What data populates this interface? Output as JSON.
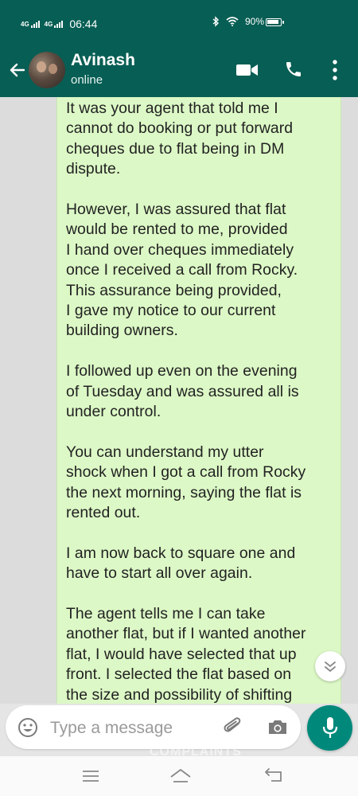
{
  "status_bar": {
    "network1": "4G",
    "network2": "4G",
    "time": "06:44",
    "bluetooth_icon": "bluetooth-icon",
    "wifi_icon": "wifi-icon",
    "battery_percent": "90%",
    "battery_level": 0.9
  },
  "header": {
    "contact_name": "Avinash",
    "contact_status": "online",
    "icons": [
      "back-arrow-icon",
      "avatar",
      "video-call-icon",
      "phone-call-icon",
      "more-vert-icon"
    ]
  },
  "chat": {
    "background": "#dcdcdc",
    "bubble_color": "#dcf8c6",
    "paragraphs": [
      "It was your agent that told me I\ncannot do booking or put forward\ncheques due to flat being in DM\ndispute.",
      "However, I was assured that flat\nwould be rented to me, provided\nI hand over cheques immediately\nonce I received a call from Rocky.\nThis assurance being provided,\nI gave my notice to our current\nbuilding owners.",
      "I followed up even on the evening\nof Tuesday and was assured all is\nunder control.",
      "You can understand my utter\nshock when I got a call from Rocky\nthe next morning, saying the flat is\nrented out.",
      "I am now back to square one and\nhave to start all over again.",
      "The agent tells me I can take\nanother flat, but if I wanted another\nflat, I would have selected that up\nfront. I selected the flat based on\nthe size and possibility of shifting"
    ]
  },
  "input": {
    "placeholder": "Type a message",
    "value": "",
    "icons": [
      "emoji-icon",
      "attach-icon",
      "camera-icon",
      "mic-icon"
    ]
  },
  "watermark": "COMPLAINTS",
  "colors": {
    "primary": "#075e54",
    "accent": "#00897b",
    "bubble": "#dcf8c6"
  },
  "nav_bar": {
    "icons": [
      "menu-icon",
      "home-icon",
      "back-icon"
    ]
  }
}
